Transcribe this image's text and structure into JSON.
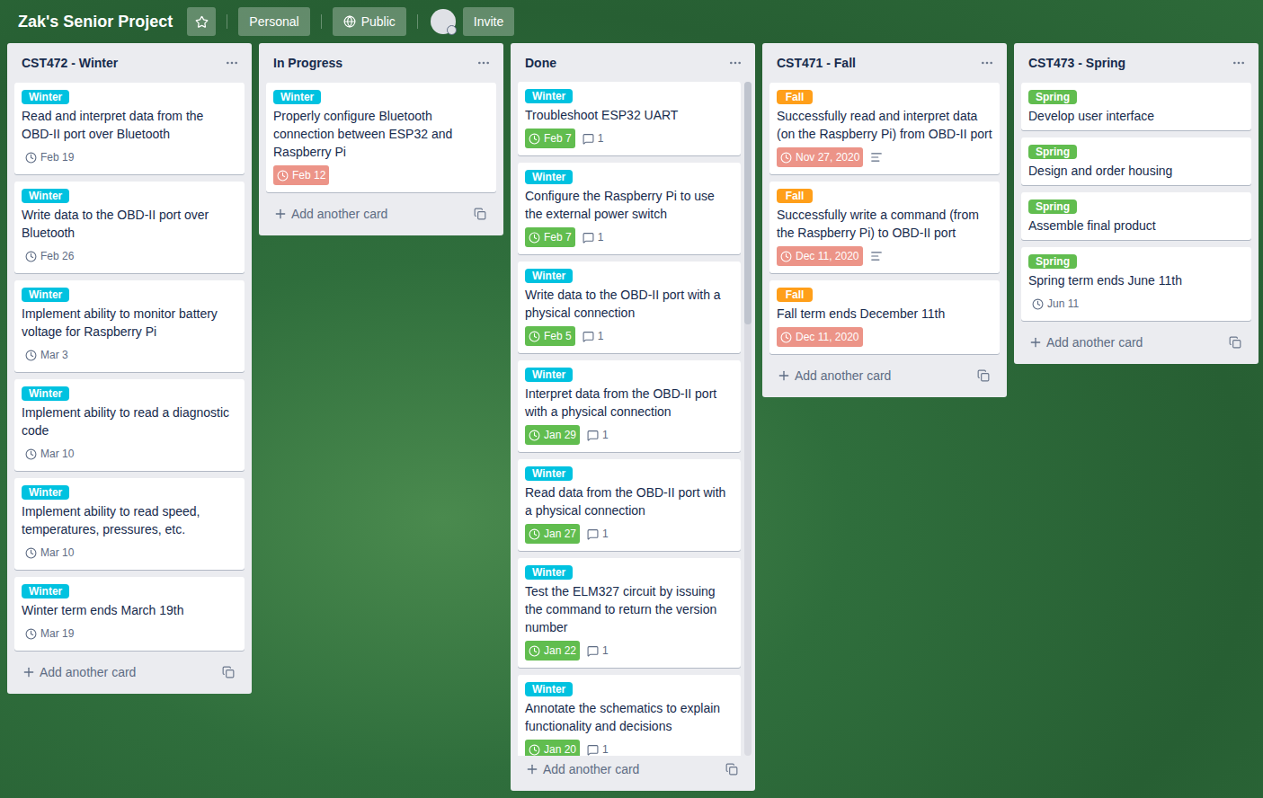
{
  "board": {
    "title": "Zak's Senior Project",
    "starred": false,
    "team": "Personal",
    "visibility": "Public",
    "invite": "Invite"
  },
  "lists": [
    {
      "title": "CST472 - Winter",
      "add_label": "Add another card",
      "cards": [
        {
          "label": {
            "text": "Winter",
            "color": "#00c2e0"
          },
          "title": "Read and interpret data from the OBD-II port over Bluetooth",
          "due": "Feb 19",
          "due_status": "upcoming"
        },
        {
          "label": {
            "text": "Winter",
            "color": "#00c2e0"
          },
          "title": "Write data to the OBD-II port over Bluetooth",
          "due": "Feb 26",
          "due_status": "upcoming"
        },
        {
          "label": {
            "text": "Winter",
            "color": "#00c2e0"
          },
          "title": "Implement ability to monitor battery voltage for Raspberry Pi",
          "due": "Mar 3",
          "due_status": "upcoming"
        },
        {
          "label": {
            "text": "Winter",
            "color": "#00c2e0"
          },
          "title": "Implement ability to read a diagnostic code",
          "due": "Mar 10",
          "due_status": "upcoming"
        },
        {
          "label": {
            "text": "Winter",
            "color": "#00c2e0"
          },
          "title": "Implement ability to read speed, temperatures, pressures, etc.",
          "due": "Mar 10",
          "due_status": "upcoming"
        },
        {
          "label": {
            "text": "Winter",
            "color": "#00c2e0"
          },
          "title": "Winter term ends March 19th",
          "due": "Mar 19",
          "due_status": "upcoming"
        }
      ]
    },
    {
      "title": "In Progress",
      "add_label": "Add another card",
      "cards": [
        {
          "label": {
            "text": "Winter",
            "color": "#00c2e0"
          },
          "title": "Properly configure Bluetooth connection between ESP32 and Raspberry Pi",
          "due": "Feb 12",
          "due_status": "overdue"
        }
      ]
    },
    {
      "title": "Done",
      "add_label": "Add another card",
      "scroll_level": 0.36,
      "cards": [
        {
          "label": {
            "text": "Winter",
            "color": "#00c2e0"
          },
          "title": "Troubleshoot ESP32 UART",
          "due": "Feb 7",
          "due_status": "complete",
          "comments": "1"
        },
        {
          "label": {
            "text": "Winter",
            "color": "#00c2e0"
          },
          "title": "Configure the Raspberry Pi to use the external power switch",
          "due": "Feb 7",
          "due_status": "complete",
          "comments": "1"
        },
        {
          "label": {
            "text": "Winter",
            "color": "#00c2e0"
          },
          "title": "Write data to the OBD-II port with a physical connection",
          "due": "Feb 5",
          "due_status": "complete",
          "comments": "1"
        },
        {
          "label": {
            "text": "Winter",
            "color": "#00c2e0"
          },
          "title": "Interpret data from the OBD-II port with a physical connection",
          "due": "Jan 29",
          "due_status": "complete",
          "comments": "1"
        },
        {
          "label": {
            "text": "Winter",
            "color": "#00c2e0"
          },
          "title": "Read data from the OBD-II port with a physical connection",
          "due": "Jan 27",
          "due_status": "complete",
          "comments": "1"
        },
        {
          "label": {
            "text": "Winter",
            "color": "#00c2e0"
          },
          "title": "Test the ELM327 circuit by issuing the command to return the version number",
          "due": "Jan 22",
          "due_status": "complete",
          "comments": "1"
        },
        {
          "label": {
            "text": "Winter",
            "color": "#00c2e0"
          },
          "title": "Annotate the schematics to explain functionality and decisions",
          "due": "Jan 20",
          "due_status": "complete",
          "comments": "1"
        }
      ]
    },
    {
      "title": "CST471 - Fall",
      "add_label": "Add another card",
      "cards": [
        {
          "label": {
            "text": "Fall",
            "color": "#ff9f1a"
          },
          "title": "Successfully read and interpret data (on the Raspberry Pi) from OBD-II port",
          "due": "Nov 27, 2020",
          "due_status": "overdue",
          "description": true
        },
        {
          "label": {
            "text": "Fall",
            "color": "#ff9f1a"
          },
          "title": "Successfully write a command (from the Raspberry Pi) to OBD-II port",
          "due": "Dec 11, 2020",
          "due_status": "overdue",
          "description": true
        },
        {
          "label": {
            "text": "Fall",
            "color": "#ff9f1a"
          },
          "title": "Fall term ends December 11th",
          "due": "Dec 11, 2020",
          "due_status": "overdue"
        }
      ]
    },
    {
      "title": "CST473 - Spring",
      "add_label": "Add another card",
      "cards": [
        {
          "label": {
            "text": "Spring",
            "color": "#61bd4f"
          },
          "title": "Develop user interface"
        },
        {
          "label": {
            "text": "Spring",
            "color": "#61bd4f"
          },
          "title": "Design and order housing"
        },
        {
          "label": {
            "text": "Spring",
            "color": "#61bd4f"
          },
          "title": "Assemble final product"
        },
        {
          "label": {
            "text": "Spring",
            "color": "#61bd4f"
          },
          "title": "Spring term ends June 11th",
          "due": "Jun 11",
          "due_status": "upcoming"
        }
      ]
    }
  ]
}
